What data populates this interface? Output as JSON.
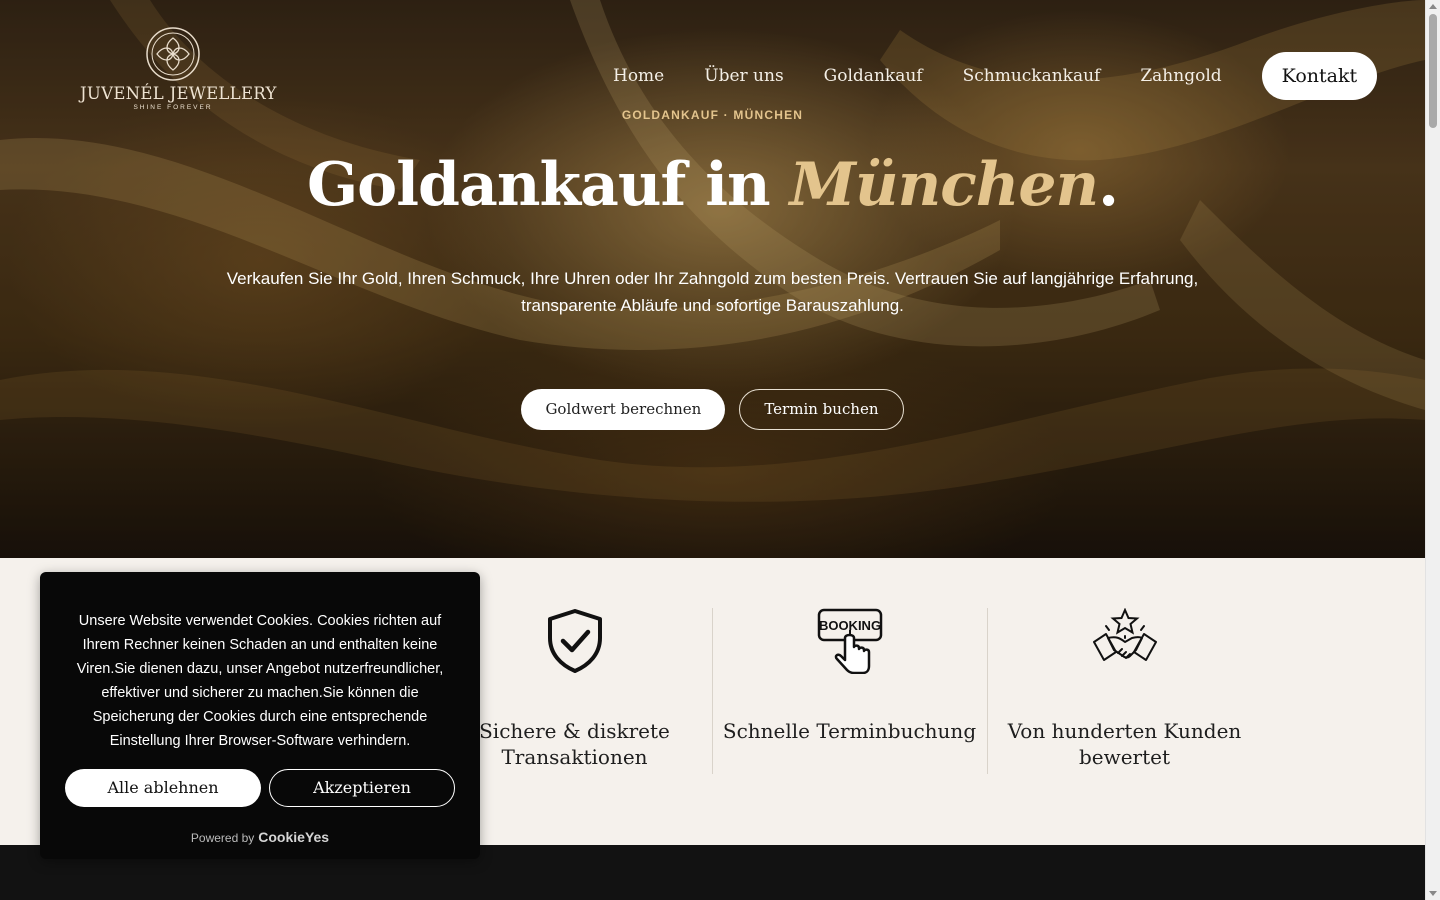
{
  "brand": {
    "name": "JUVENÉL JEWELLERY",
    "tagline": "SHINE FOREVER"
  },
  "nav": {
    "items": [
      {
        "label": "Home"
      },
      {
        "label": "Über uns"
      },
      {
        "label": "Goldankauf"
      },
      {
        "label": "Schmuckankauf"
      },
      {
        "label": "Zahngold"
      }
    ],
    "contact_label": "Kontakt"
  },
  "hero": {
    "eyebrow": "GOLDANKAUF · MÜNCHEN",
    "title_main": "Goldankauf in ",
    "title_accent": "München",
    "title_end": ".",
    "subtitle": "Verkaufen Sie Ihr Gold, Ihren Schmuck, Ihre Uhren oder Ihr Zahngold zum besten Preis. Vertrauen Sie auf langjährige Erfahrung, transparente Abläufe und sofortige Barauszahlung.",
    "primary_button": "Goldwert berechnen",
    "secondary_button": "Termin buchen"
  },
  "features": [
    {
      "title": "Sichere & diskrete Transaktionen",
      "icon": "shield-check-icon"
    },
    {
      "title": "Schnelle Terminbuchung",
      "icon": "booking-icon"
    },
    {
      "title": "Von hunderten Kunden bewertet",
      "icon": "handshake-star-icon"
    }
  ],
  "booking_icon_text": "BOOKING",
  "cookie": {
    "text": "Unsere Website verwendet Cookies. Cookies richten auf Ihrem Rechner keinen Schaden an und enthalten keine Viren.Sie dienen dazu, unser Angebot nutzerfreundlicher, effektiver und sicherer zu machen.Sie können die Speicherung der Cookies durch eine entsprechende Einstellung Ihrer Browser-Software verhindern.",
    "reject_label": "Alle ablehnen",
    "accept_label": "Akzeptieren",
    "powered_by": "Powered by",
    "powered_brand": "CookieYes"
  },
  "colors": {
    "gold_accent": "#e3c48d",
    "feature_background": "#f5f1ec",
    "dark_band": "#121212",
    "cookie_background": "#080808"
  }
}
